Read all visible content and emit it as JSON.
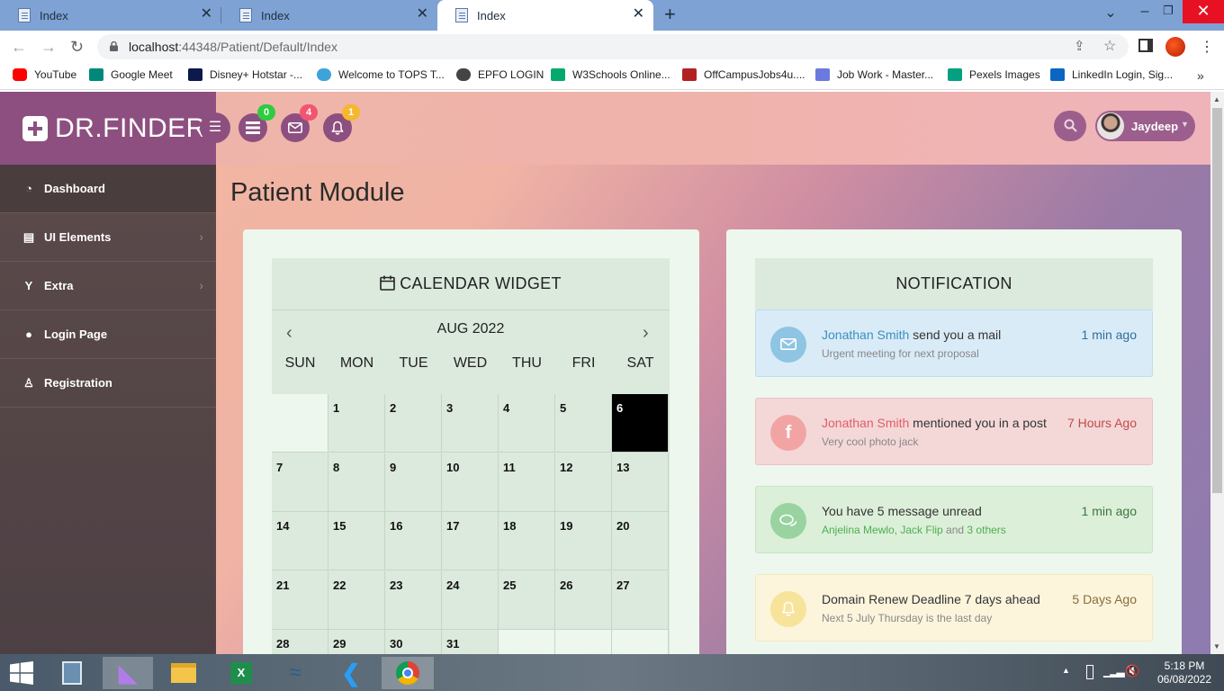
{
  "browser": {
    "tabs": [
      {
        "title": "Index",
        "active": false
      },
      {
        "title": "Index",
        "active": false
      },
      {
        "title": "Index",
        "active": true
      }
    ],
    "url_host": "localhost",
    "url_rest": ":44348/Patient/Default/Index",
    "bookmarks": [
      {
        "label": "YouTube",
        "color": "#ff0000"
      },
      {
        "label": "Google Meet",
        "color": "#00897b"
      },
      {
        "label": "Disney+ Hotstar -...",
        "color": "#0c1a4b"
      },
      {
        "label": "Welcome to TOPS T...",
        "color": "#3ea3d8"
      },
      {
        "label": "EPFO LOGIN",
        "color": "#444444"
      },
      {
        "label": "W3Schools Online...",
        "color": "#04aa6d"
      },
      {
        "label": "OffCampusJobs4u....",
        "color": "#b22222"
      },
      {
        "label": "Job Work - Master...",
        "color": "#6c7ae0"
      },
      {
        "label": "Pexels Images",
        "color": "#05a081"
      },
      {
        "label": "LinkedIn Login, Sig...",
        "color": "#0a66c2"
      }
    ]
  },
  "header": {
    "brand": "DR.FINDER",
    "badges": {
      "tasks": "0",
      "mail": "4",
      "bell": "1"
    },
    "badge_colors": {
      "tasks": "#2ecc40",
      "mail": "#f2556f",
      "bell": "#f5b82e"
    },
    "user_name": "Jaydeep"
  },
  "sidebar": {
    "items": [
      {
        "label": "Dashboard",
        "icon": "dashboard-icon",
        "chevron": false
      },
      {
        "label": "UI Elements",
        "icon": "book-icon",
        "chevron": true
      },
      {
        "label": "Extra",
        "icon": "cocktail-icon",
        "chevron": true
      },
      {
        "label": "Login Page",
        "icon": "user-icon",
        "chevron": false
      },
      {
        "label": "Registration",
        "icon": "user-plus-icon",
        "chevron": false
      }
    ]
  },
  "page": {
    "title": "Patient Module"
  },
  "calendar": {
    "title": "CALENDAR WIDGET",
    "month": "AUG 2022",
    "weekdays": [
      "SUN",
      "MON",
      "TUE",
      "WED",
      "THU",
      "FRI",
      "SAT"
    ],
    "first_weekday_index": 1,
    "days_in_month": 31,
    "today": 6
  },
  "notifications": {
    "title": "NOTIFICATION",
    "items": [
      {
        "name": "Jonathan Smith",
        "text": " send you a mail",
        "sub": "Urgent meeting for next proposal",
        "time": "1 min ago",
        "icon": "mail-icon",
        "bg": "#d9ebf7",
        "border": "#bcdcef",
        "accent": "#3a8fc0",
        "iconbg": "#8fc4e3",
        "timecolor": "#2f6f99"
      },
      {
        "name": "Jonathan Smith",
        "text": " mentioned you in a post",
        "sub": "Very cool photo jack",
        "time": "7 Hours Ago",
        "icon": "facebook-icon",
        "bg": "#f4d8d8",
        "border": "#ecc2c2",
        "accent": "#e05d6a",
        "iconbg": "#f2a4a4",
        "timecolor": "#c24a4a"
      },
      {
        "name": "",
        "text": "You have 5 message unread",
        "sub_parts": [
          "Anjelina Mewlo, Jack Flip",
          " and ",
          "3 others"
        ],
        "time": "1 min ago",
        "icon": "comments-icon",
        "bg": "#dcefd9",
        "border": "#c8e4c4",
        "accent": "#4caf50",
        "iconbg": "#98d3a0",
        "timecolor": "#3c763d"
      },
      {
        "name": "",
        "text": "Domain Renew Deadline 7 days ahead",
        "sub": "Next 5 July Thursday is the last day",
        "time": "5 Days Ago",
        "icon": "bell-icon",
        "bg": "#fcf5dc",
        "border": "#f3e8bf",
        "accent": "#8a6d3b",
        "iconbg": "#f7e39a",
        "timecolor": "#8a6d3b"
      }
    ]
  },
  "taskbar": {
    "time": "5:18 PM",
    "date": "06/08/2022",
    "apps": [
      "calculator-icon",
      "visual-studio-icon",
      "file-explorer-icon",
      "excel-icon",
      "mysql-icon",
      "vscode-icon",
      "chrome-icon"
    ]
  }
}
